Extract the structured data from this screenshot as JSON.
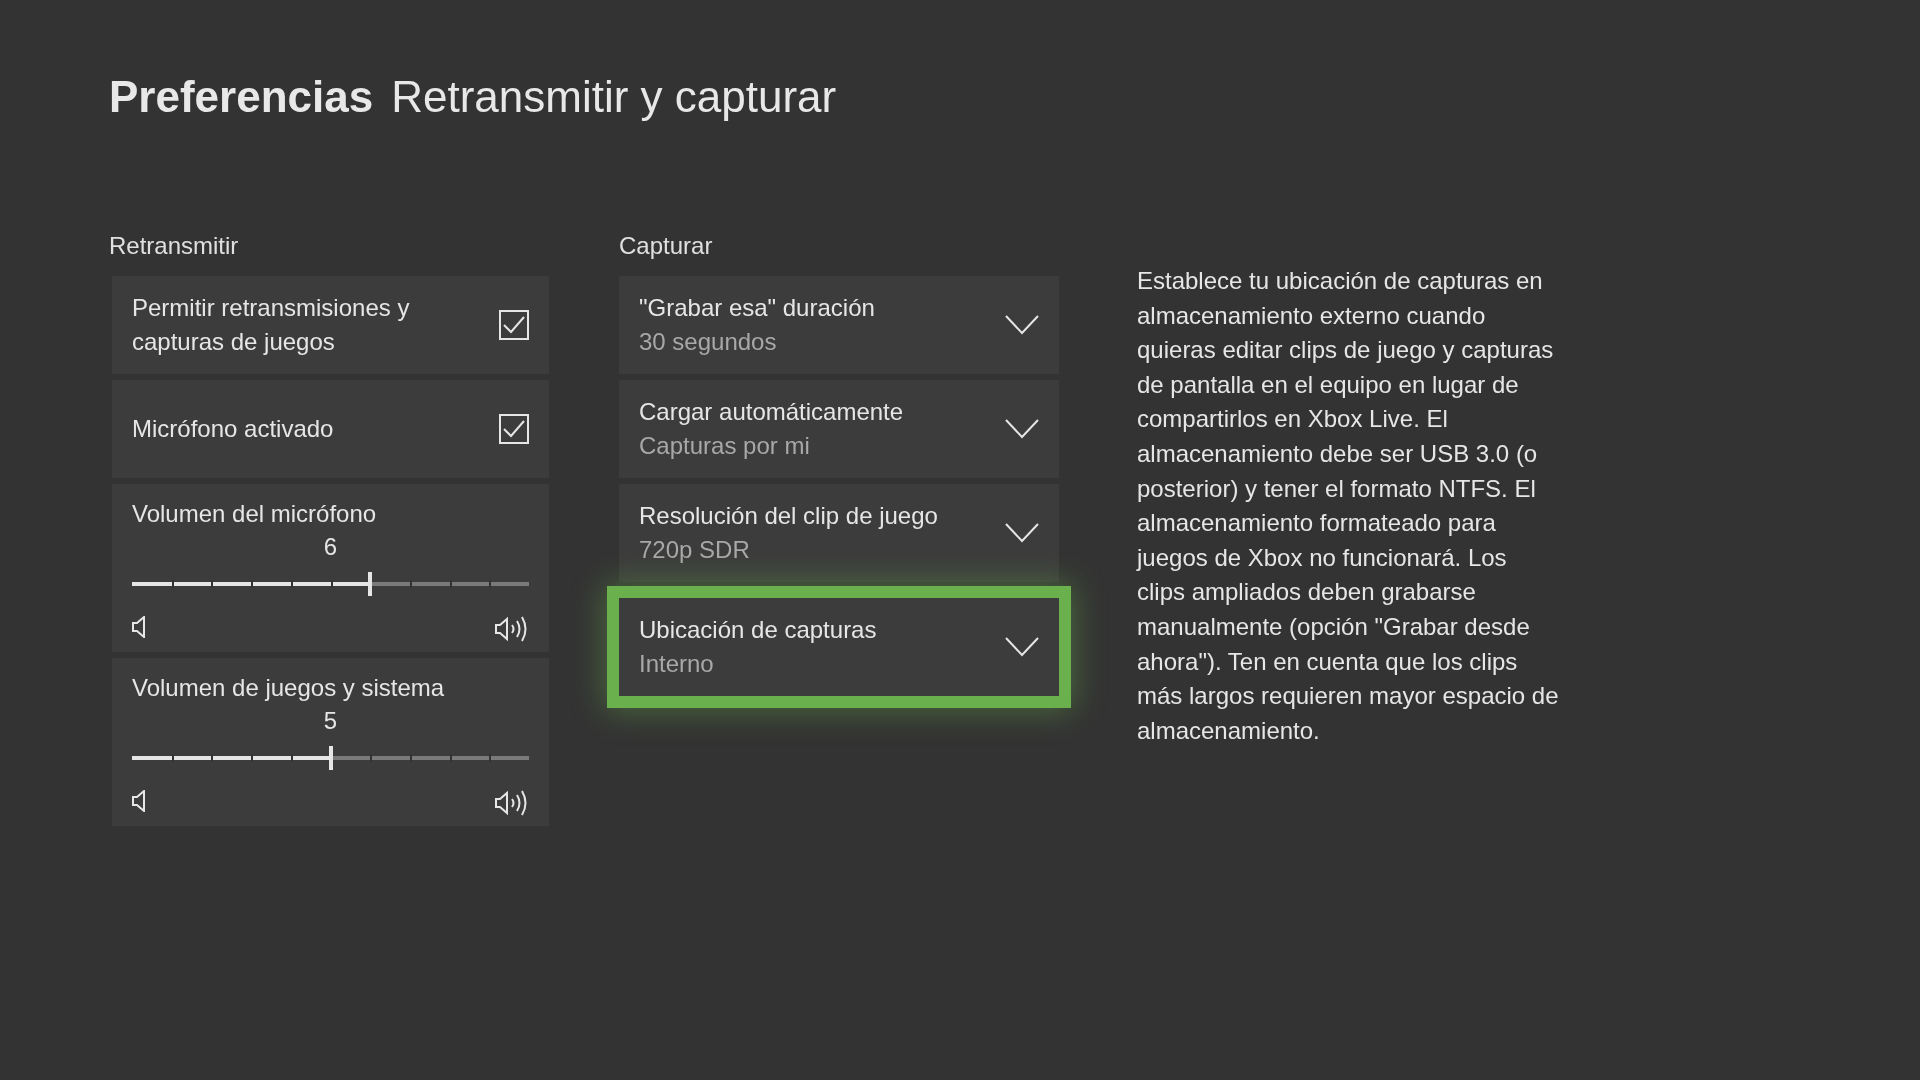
{
  "header": {
    "section": "Preferencias",
    "title": "Retransmitir y capturar"
  },
  "broadcast": {
    "heading": "Retransmitir",
    "items": [
      {
        "kind": "checkbox",
        "label": "Permitir retransmisiones y capturas de juegos",
        "checked": true
      },
      {
        "kind": "checkbox",
        "label": "Micrófono activado",
        "checked": true
      },
      {
        "kind": "slider",
        "label": "Volumen del micrófono",
        "reading": "6",
        "level": 0.6
      },
      {
        "kind": "slider",
        "label": "Volumen de juegos y sistema",
        "reading": "5",
        "level": 0.5
      }
    ]
  },
  "capture": {
    "heading": "Capturar",
    "items": [
      {
        "label": "\"Grabar esa\" duración",
        "value": "30 segundos",
        "focused": false
      },
      {
        "label": "Cargar automáticamente",
        "value": "Capturas por mi",
        "focused": false
      },
      {
        "label": "Resolución del clip de juego",
        "value": "720p SDR",
        "focused": false
      },
      {
        "label": "Ubicación de capturas",
        "value": "Interno",
        "focused": true
      }
    ]
  },
  "description": "Establece tu ubicación de capturas en almacenamiento externo cuando quieras editar clips de juego y capturas de pantalla en el equipo en lugar de compartirlos en Xbox Live. El almacenamiento debe ser USB 3.0 (o posterior) y tener el formato NTFS. El almacenamiento formateado para juegos de Xbox no funcionará. Los clips ampliados deben grabarse manualmente (opción \"Grabar desde ahora\"). Ten en cuenta que los clips más largos requieren mayor espacio de almacenamiento."
}
